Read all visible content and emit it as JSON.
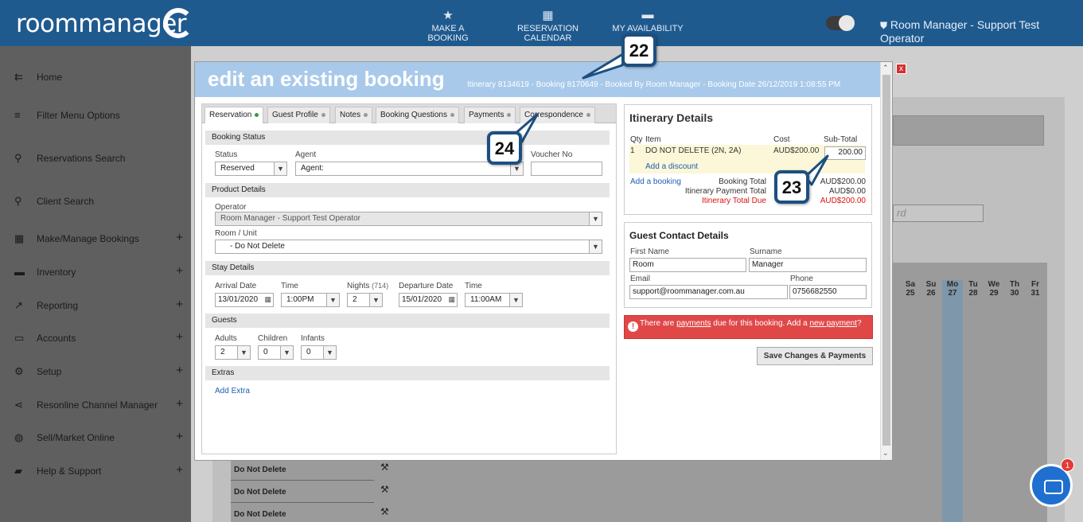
{
  "topbar": {
    "logo_text": "roommanager",
    "nav": [
      {
        "label": "MAKE A BOOKING",
        "icon": "star-icon"
      },
      {
        "label": "RESERVATION CALENDAR",
        "icon": "calendar-icon"
      },
      {
        "label": "MY AVAILABILITY",
        "icon": "bed-icon"
      }
    ],
    "operator": "Room Manager - Support Test Operator"
  },
  "sidebar": {
    "items": [
      {
        "label": "Home",
        "icon": "arrow-left-icon",
        "plus": ""
      },
      {
        "label": "Filter Menu Options",
        "icon": "filter-icon",
        "plus": ""
      },
      {
        "label": "Reservations Search",
        "icon": "search-icon",
        "plus": ""
      },
      {
        "label": "Client Search",
        "icon": "search-icon",
        "plus": ""
      },
      {
        "label": "Make/Manage Bookings",
        "icon": "calendar-check-icon",
        "plus": "+"
      },
      {
        "label": "Inventory",
        "icon": "bed-icon",
        "plus": "+"
      },
      {
        "label": "Reporting",
        "icon": "chart-line-icon",
        "plus": "+"
      },
      {
        "label": "Accounts",
        "icon": "credit-card-icon",
        "plus": "+"
      },
      {
        "label": "Setup",
        "icon": "gear-icon",
        "plus": "+"
      },
      {
        "label": "Resonline Channel Manager",
        "icon": "share-icon",
        "plus": "+"
      },
      {
        "label": "Sell/Market Online",
        "icon": "globe-icon",
        "plus": "+"
      },
      {
        "label": "Help & Support",
        "icon": "chat-icon",
        "plus": "+"
      }
    ]
  },
  "background": {
    "days": [
      {
        "dow": "Sa",
        "num": "25"
      },
      {
        "dow": "Su",
        "num": "26"
      },
      {
        "dow": "Mo",
        "num": "27"
      },
      {
        "dow": "Tu",
        "num": "28"
      },
      {
        "dow": "We",
        "num": "29"
      },
      {
        "dow": "Th",
        "num": "30"
      },
      {
        "dow": "Fr",
        "num": "31"
      }
    ],
    "rows": [
      "Do Not Delete",
      "Do Not Delete",
      "Do Not Delete"
    ],
    "input_fragment": "rd"
  },
  "modal": {
    "title": "edit an existing booking",
    "subtitle": "Itinerary 8134619 - Booking 8170649 - Booked By Room Manager - Booking Date 26/12/2019 1:08:55 PM",
    "tabs": [
      "Reservation",
      "Guest Profile",
      "Notes",
      "Booking Questions",
      "Payments",
      "Correspondence"
    ],
    "booking_status": {
      "section": "Booking Status",
      "status_label": "Status",
      "status_value": "Reserved",
      "agent_label": "Agent",
      "agent_value": "Agent:",
      "voucher_label": "Voucher No",
      "voucher_value": ""
    },
    "product": {
      "section": "Product Details",
      "operator_label": "Operator",
      "operator_value": "Room Manager - Support Test Operator",
      "room_label": "Room / Unit",
      "room_value": "- Do Not Delete"
    },
    "stay": {
      "section": "Stay Details",
      "arrival_label": "Arrival Date",
      "arrival_value": "13/01/2020",
      "time_label": "Time",
      "time_value": "1:00PM",
      "nights_label": "Nights",
      "nights_extra": "(714)",
      "nights_value": "2",
      "departure_label": "Departure Date",
      "departure_value": "15/01/2020",
      "dtime_label": "Time",
      "dtime_value": "11:00AM"
    },
    "guests": {
      "section": "Guests",
      "adults_label": "Adults",
      "adults_value": "2",
      "children_label": "Children",
      "children_value": "0",
      "infants_label": "Infants",
      "infants_value": "0"
    },
    "extras": {
      "section": "Extras",
      "add_extra": "Add Extra"
    },
    "itinerary": {
      "title": "Itinerary Details",
      "col_qty": "Qty",
      "col_item": "Item",
      "col_cost": "Cost",
      "col_subtotal": "Sub-Total",
      "line_qty": "1",
      "line_item": "DO NOT DELETE (2N, 2A)",
      "line_cost": "AUD$200.00",
      "line_subtotal": "200.00",
      "add_discount": "Add a discount",
      "add_booking": "Add a booking",
      "booking_total_label": "Booking Total",
      "booking_total_value": "AUD$200.00",
      "payment_total_label": "Itinerary Payment Total",
      "payment_total_value": "AUD$0.00",
      "total_due_label": "Itinerary Total Due",
      "total_due_value": "AUD$200.00"
    },
    "guest_contact": {
      "title": "Guest Contact Details",
      "first_label": "First Name",
      "first_value": "Room",
      "surname_label": "Surname",
      "surname_value": "Manager",
      "email_label": "Email",
      "email_value": "support@roommanager.com.au",
      "phone_label": "Phone",
      "phone_value": "0756682550"
    },
    "alert": {
      "pre": "There are ",
      "link1": "payments",
      "mid": " due for this booking. Add a ",
      "link2": "new payment",
      "post": "?"
    },
    "save_button": "Save Changes & Payments",
    "close_label": "x"
  },
  "callouts": [
    "22",
    "23",
    "24"
  ],
  "chat_badge": "1"
}
